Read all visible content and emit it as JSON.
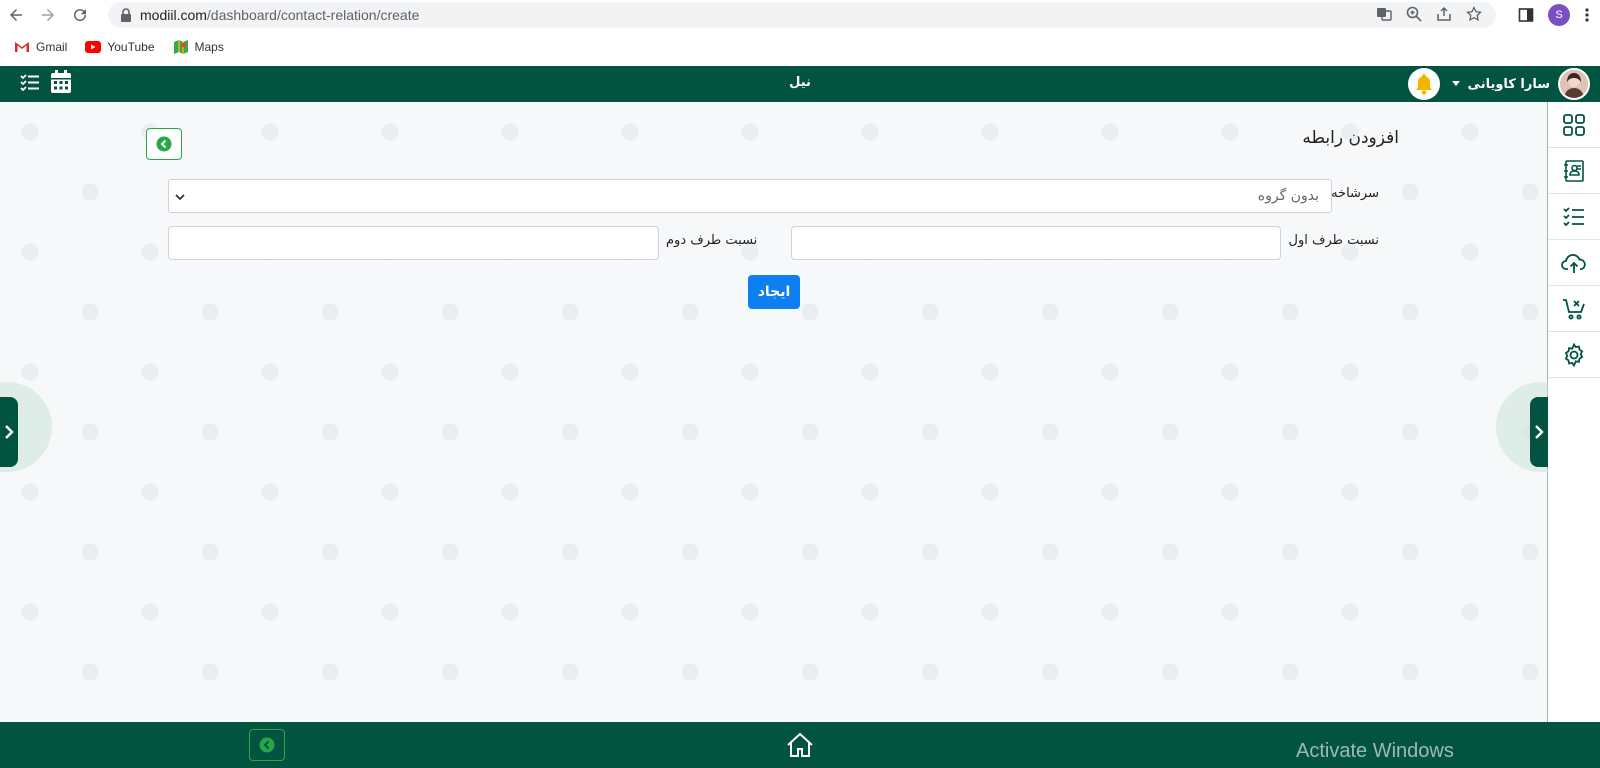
{
  "browser": {
    "url_host": "modiil.com",
    "url_path": "/dashboard/contact-relation/create",
    "profile_initial": "S",
    "bookmarks": [
      {
        "label": "Gmail",
        "icon": "gmail-icon"
      },
      {
        "label": "YouTube",
        "icon": "youtube-icon"
      },
      {
        "label": "Maps",
        "icon": "maps-icon"
      }
    ]
  },
  "header": {
    "title": "نیل",
    "user_name": "سارا کاویانی"
  },
  "form": {
    "heading": "افزودن رابطه",
    "parent_label": "سرشاخه",
    "parent_value": "بدون گروه",
    "first_party_label": "نسبت طرف اول",
    "second_party_label": "نسبت طرف دوم",
    "submit_label": "ایجاد"
  },
  "sidebar": {
    "items": [
      "grid-icon",
      "contacts-book-icon",
      "checklist-icon",
      "cloud-upload-icon",
      "cart-remove-icon",
      "gear-icon"
    ]
  },
  "watermark": "Activate Windows",
  "colors": {
    "primary": "#02533f",
    "accent": "#0d7ff0",
    "success": "#28a745"
  }
}
